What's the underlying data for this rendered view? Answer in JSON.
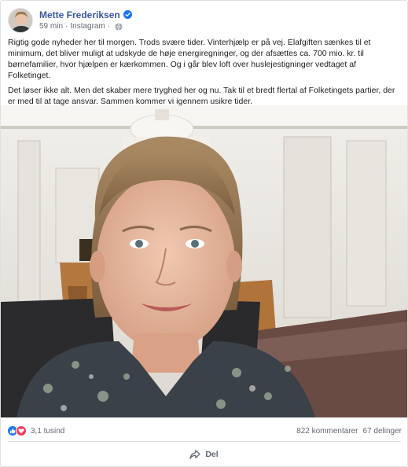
{
  "post": {
    "author": "Mette Frederiksen",
    "time": "59 min",
    "separator": "·",
    "source": "Instagram",
    "paragraph_1": "Rigtig gode nyheder her til morgen. Trods svære tider. Vinterhjælp er på vej. Elafgiften sænkes til et minimum, det bliver muligt at udskyde de høje energiregninger, og der afsættes ca. 700 mio. kr. til børnefamilier, hvor hjælpen er kærkommen. Og i går blev loft over huslejestigninger vedtaget af Folketinget.",
    "paragraph_2": "Det løser ikke alt. Men det skaber mere tryghed her og nu. Tak til et bredt flertal af Folketingets partier, der er med til at tage ansvar. Sammen kommer vi igennem usikre tider."
  },
  "stats": {
    "reactions_count": "3,1 tusind",
    "comments": "822 kommentarer",
    "shares": "67 delinger"
  },
  "actions": {
    "share_label": "Del"
  },
  "colors": {
    "author_link": "#385898",
    "like_blue": "#1877f2",
    "love_red": "#f33e58",
    "verified_blue": "#1877f2"
  },
  "icons": [
    "verified-badge-icon",
    "globe-icon",
    "like-reaction-icon",
    "love-reaction-icon",
    "share-arrow-icon"
  ]
}
